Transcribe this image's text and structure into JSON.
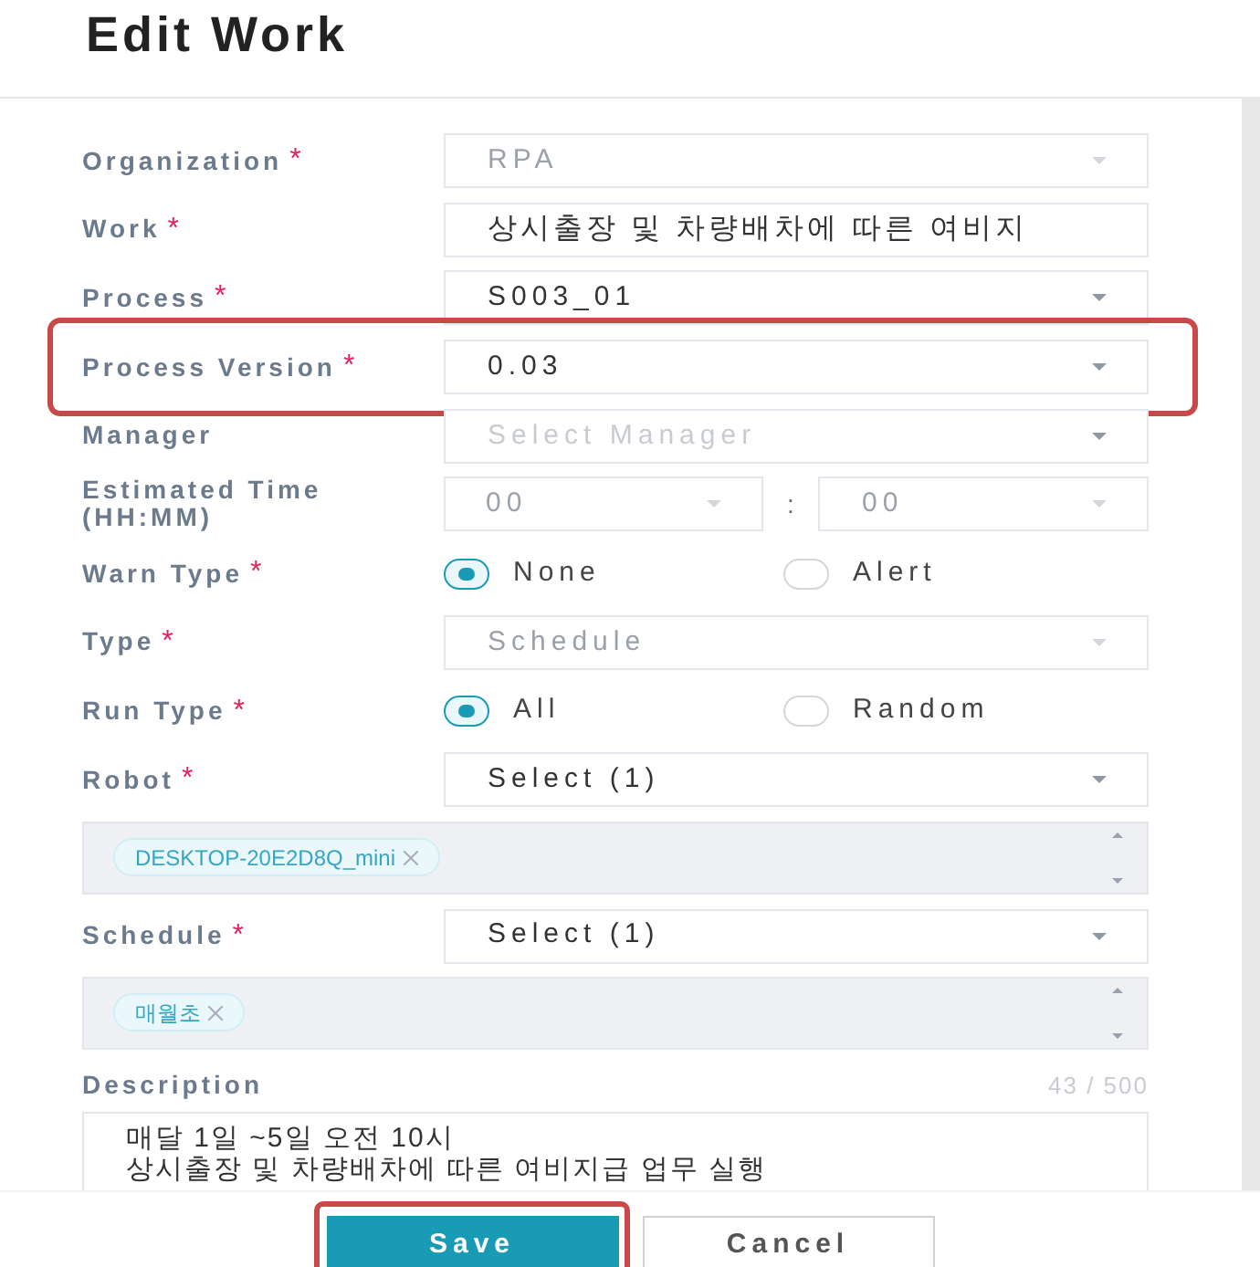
{
  "title": "Edit Work",
  "fields": [
    {
      "kind": "select",
      "label": "Organization",
      "mark": "*",
      "value": "RPA",
      "disabled": true
    },
    {
      "kind": "text",
      "label": "Work",
      "mark": "*",
      "value": "상시출장 및 차량배차에 따른 여비지"
    },
    {
      "kind": "select",
      "label": "Process",
      "mark": "*",
      "value": "S003_01",
      "disabled": false
    },
    {
      "kind": "select",
      "label": "Process Version",
      "mark": "*",
      "value": "0.03",
      "disabled": false,
      "highlighted": true
    },
    {
      "kind": "select",
      "label": "Manager",
      "placeholder": "Select Manager",
      "disabled": false
    },
    {
      "kind": "time",
      "label": "Estimated Time (HH:MM)",
      "hours": "00",
      "separator": ":",
      "minutes": "00",
      "disabled": true
    },
    {
      "kind": "radio",
      "label": "Warn Type",
      "mark": "*",
      "options": [
        {
          "label": "None",
          "selected": true
        },
        {
          "label": "Alert",
          "selected": false
        }
      ]
    },
    {
      "kind": "select",
      "label": "Type",
      "mark": "*",
      "value": "Schedule",
      "disabled": true
    },
    {
      "kind": "radio",
      "label": "Run Type",
      "mark": "*",
      "options": [
        {
          "label": "All",
          "selected": true
        },
        {
          "label": "Random",
          "selected": false
        }
      ]
    },
    {
      "kind": "select",
      "label": "Robot",
      "mark": "*",
      "value": "Select (1)",
      "disabled": false,
      "tags": [
        "DESKTOP-20E2D8Q_mini"
      ]
    },
    {
      "kind": "select",
      "label": "Schedule",
      "mark": "*",
      "value": "Select (1)",
      "disabled": false,
      "tags": [
        "매월초"
      ]
    },
    {
      "kind": "textarea",
      "label": "Description",
      "counter": "43 / 500",
      "lines": [
        "매달 1일 ~5일 오전 10시",
        "상시출장 및 차량배차에 따른 여비지급 업무 실행"
      ]
    }
  ],
  "buttons": [
    {
      "kind": "primary",
      "label": "Save",
      "highlighted": true
    },
    {
      "kind": "secondary",
      "label": "Cancel",
      "highlighted": false
    }
  ]
}
